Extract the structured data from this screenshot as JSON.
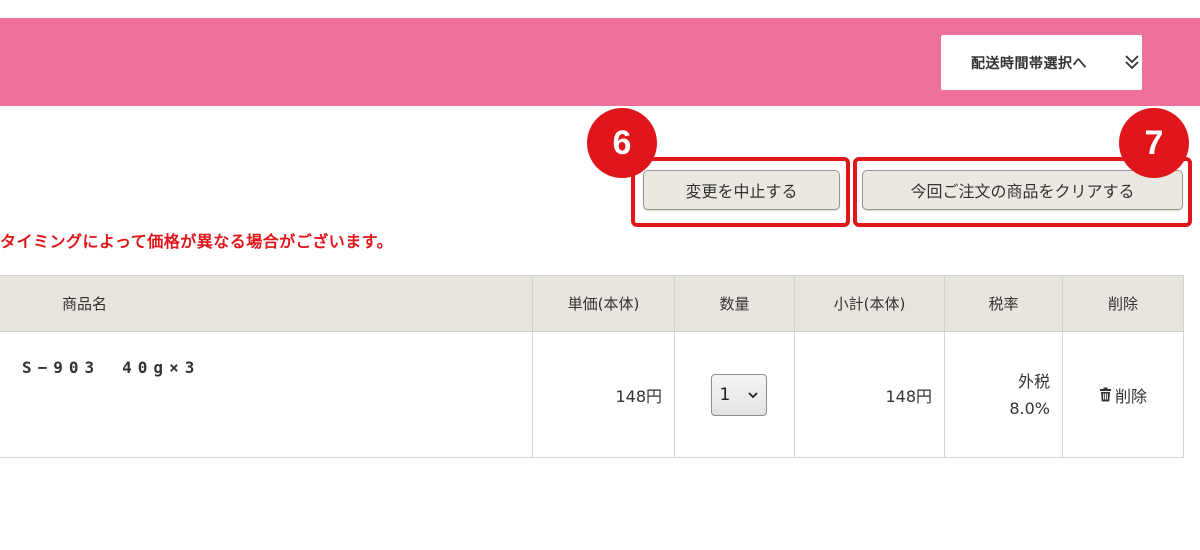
{
  "header": {
    "delivery_button_label": "配送時間帯選択へ",
    "delivery_icon": "double-chevron-down-icon",
    "bar_color": "#ee719d"
  },
  "actions": {
    "cancel_change_label": "変更を中止する",
    "clear_items_label": "今回ご注文の商品をクリアする",
    "badge_cancel": "6",
    "badge_clear": "7",
    "highlight_color": "#e0161b"
  },
  "notice_text": "タイミングによって価格が異なる場合がございます。",
  "table": {
    "headers": {
      "name": "商品名",
      "unit_price": "単価(本体)",
      "quantity": "数量",
      "subtotal": "小計(本体)",
      "tax_rate": "税率",
      "delete": "削除"
    },
    "rows": [
      {
        "name": "S−903　40g×3",
        "unit_price": "148円",
        "quantity": "1",
        "subtotal": "148円",
        "tax_type": "外税",
        "tax_rate": "8.0%",
        "delete_label": "削除",
        "delete_icon": "trash-icon"
      }
    ]
  }
}
